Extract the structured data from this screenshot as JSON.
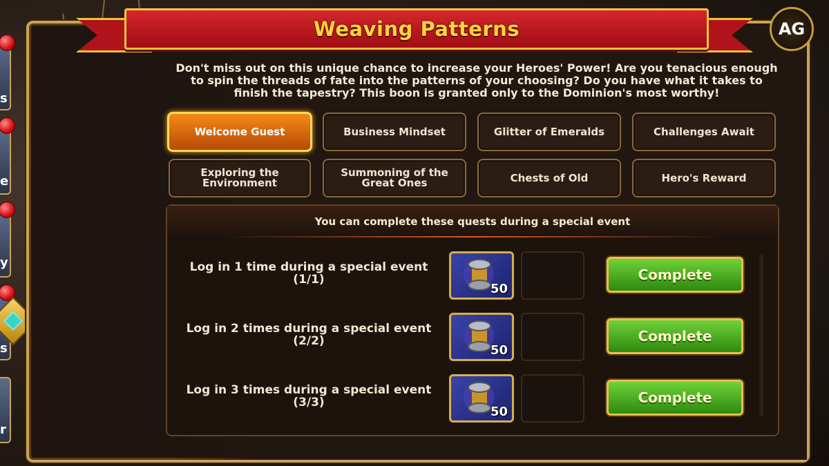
{
  "title": "Weaving Patterns",
  "logo_text": "AG",
  "description": "Don't miss out on this unique chance to increase your Heroes' Power! Are you tenacious enough to spin the threads of fate into the patterns of your choosing? Do you have what it takes to finish the tapestry? This boon is granted only to the Dominion's most worthy!",
  "tabs": [
    {
      "label": "Welcome Guest",
      "active": true
    },
    {
      "label": "Business Mindset"
    },
    {
      "label": "Glitter of Emeralds"
    },
    {
      "label": "Challenges Await"
    },
    {
      "label": "Exploring the Environment"
    },
    {
      "label": "Summoning of the Great Ones"
    },
    {
      "label": "Chests of Old"
    },
    {
      "label": "Hero's Reward"
    }
  ],
  "quests_header": "You can complete these quests during a special event",
  "quests": [
    {
      "text": "Log in 1 time during a special event",
      "progress": "(1/1)",
      "reward_icon": "spool-icon",
      "reward_count": "50",
      "button": "Complete"
    },
    {
      "text": "Log in 2 times during a special event",
      "progress": "(2/2)",
      "reward_icon": "spool-icon",
      "reward_count": "50",
      "button": "Complete"
    },
    {
      "text": "Log in 3 times during a special event",
      "progress": "(3/3)",
      "reward_icon": "spool-icon",
      "reward_count": "50",
      "button": "Complete"
    }
  ],
  "side_letters": [
    "s",
    "e",
    "y",
    "s",
    "r"
  ],
  "colors": {
    "accent_gold": "#f2c640",
    "ribbon_red": "#b0141a",
    "active_tab": "#f58a18",
    "complete_green": "#3faa18"
  }
}
